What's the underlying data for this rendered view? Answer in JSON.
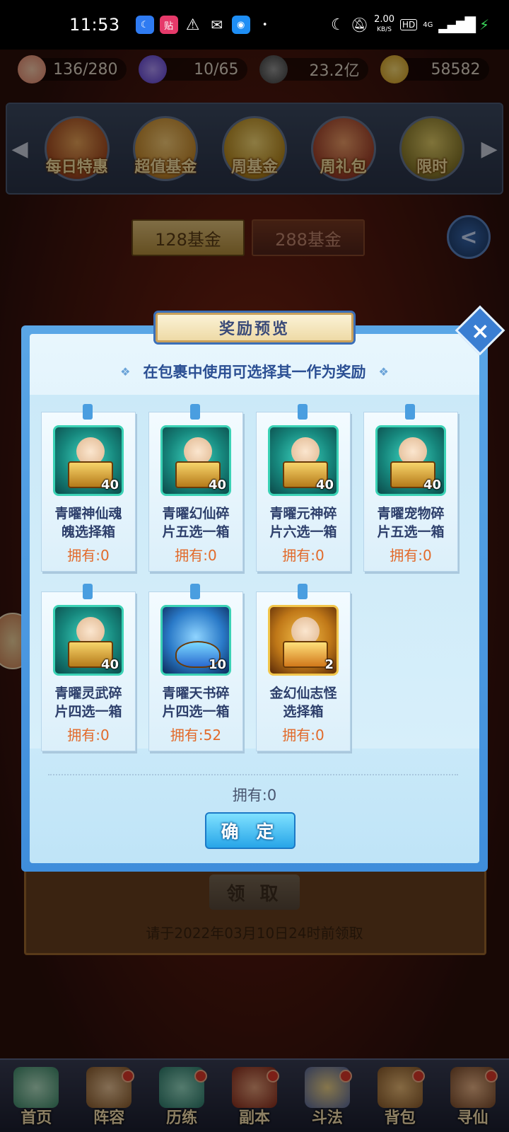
{
  "status_bar": {
    "time": "11:53",
    "network_speed": "2.00",
    "network_unit": "KB/S",
    "hd_label": "HD",
    "signal_label": "4G"
  },
  "resources": [
    {
      "icon": "peach-icon",
      "value": "136/280"
    },
    {
      "icon": "spirit-flame-icon",
      "value": "10/65"
    },
    {
      "icon": "coin-icon",
      "value": "23.2亿"
    },
    {
      "icon": "gold-ingot-icon",
      "value": "58582"
    }
  ],
  "shop_tabs": [
    {
      "label": "每日特惠"
    },
    {
      "label": "超值基金"
    },
    {
      "label": "周基金"
    },
    {
      "label": "周礼包"
    },
    {
      "label": "限时"
    }
  ],
  "fund_tabs": {
    "fund_128": "128基金",
    "fund_288": "288基金"
  },
  "background": {
    "claim_label": "领 取",
    "deadline": "请于2022年03月10日24时前领取"
  },
  "modal": {
    "title": "奖励预览",
    "subtitle": "在包裹中使用可选择其一作为奖励",
    "items": [
      {
        "name_line1": "青曜神仙魂",
        "name_line2": "魄选择箱",
        "count": "40",
        "owned": "拥有:0",
        "frame": "teal"
      },
      {
        "name_line1": "青曜幻仙碎",
        "name_line2": "片五选一箱",
        "count": "40",
        "owned": "拥有:0",
        "frame": "teal"
      },
      {
        "name_line1": "青曜元神碎",
        "name_line2": "片六选一箱",
        "count": "40",
        "owned": "拥有:0",
        "frame": "teal"
      },
      {
        "name_line1": "青曜宠物碎",
        "name_line2": "片五选一箱",
        "count": "40",
        "owned": "拥有:0",
        "frame": "teal"
      },
      {
        "name_line1": "青曜灵武碎",
        "name_line2": "片四选一箱",
        "count": "40",
        "owned": "拥有:0",
        "frame": "teal"
      },
      {
        "name_line1": "青曜天书碎",
        "name_line2": "片四选一箱",
        "count": "10",
        "owned": "拥有:52",
        "frame": "teal"
      },
      {
        "name_line1": "金幻仙志怪",
        "name_line2": "选择箱",
        "count": "2",
        "owned": "拥有:0",
        "frame": "gold"
      }
    ],
    "owned_total": "拥有:0",
    "confirm_label": "确 定"
  },
  "bottom_nav": [
    {
      "label": "首页",
      "badge": false
    },
    {
      "label": "阵容",
      "badge": true
    },
    {
      "label": "历练",
      "badge": true
    },
    {
      "label": "副本",
      "badge": true
    },
    {
      "label": "斗法",
      "badge": true
    },
    {
      "label": "背包",
      "badge": true
    },
    {
      "label": "寻仙",
      "badge": true
    }
  ]
}
